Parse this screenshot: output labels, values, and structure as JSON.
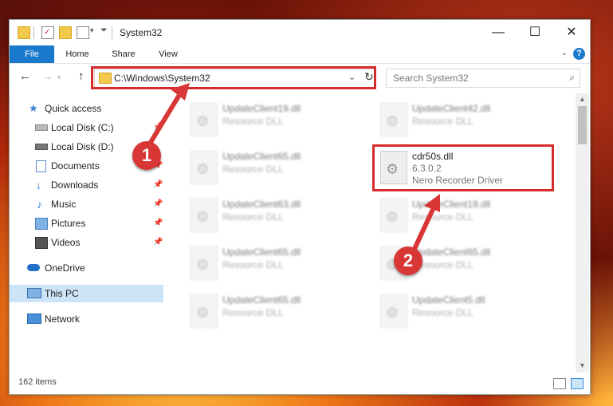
{
  "window": {
    "title": "System32"
  },
  "ribbon": {
    "tabs": [
      "File",
      "Home",
      "Share",
      "View"
    ],
    "help": "?"
  },
  "nav": {
    "back": "←",
    "forward": "→",
    "up": "↑",
    "address": "C:\\Windows\\System32",
    "search_placeholder": "Search System32"
  },
  "sidebar": {
    "items": [
      {
        "label": "Quick access",
        "icon": "star-icon"
      },
      {
        "label": "Local Disk (C:)",
        "icon": "drive-icon"
      },
      {
        "label": "Local Disk (D:)",
        "icon": "drive-icon"
      },
      {
        "label": "Documents",
        "icon": "documents-icon"
      },
      {
        "label": "Downloads",
        "icon": "download-icon"
      },
      {
        "label": "Music",
        "icon": "music-icon"
      },
      {
        "label": "Pictures",
        "icon": "pictures-icon"
      },
      {
        "label": "Videos",
        "icon": "videos-icon"
      },
      {
        "label": "OneDrive",
        "icon": "cloud-icon"
      },
      {
        "label": "This PC",
        "icon": "computer-icon"
      },
      {
        "label": "Network",
        "icon": "network-icon"
      }
    ]
  },
  "files": {
    "left": [
      {
        "name": "UpdateClient19.dll",
        "type": "Resource DLL"
      },
      {
        "name": "UpdateClient65.dll",
        "type": "Resource DLL"
      },
      {
        "name": "UpdateClient63.dll",
        "type": "Resource DLL"
      },
      {
        "name": "UpdateClient65.dll",
        "type": "Resource DLL"
      },
      {
        "name": "UpdateClient65.dll",
        "type": "Resource DLL"
      }
    ],
    "right": [
      {
        "name": "UpdateClient42.dll",
        "type": "Resource DLL"
      },
      {
        "name": "UpdateClient19.dll",
        "type": "Resource DLL"
      },
      {
        "name": "UpdateClient65.dll",
        "type": "Resource DLL"
      },
      {
        "name": "UpdateClient5.dll",
        "type": "Resource DLL"
      }
    ],
    "highlight": {
      "name": "cdr50s.dll",
      "version": "6.3.0.2",
      "description": "Nero Recorder Driver"
    }
  },
  "status": {
    "count": "162 items"
  },
  "annotations": {
    "badge1": "1",
    "badge2": "2"
  },
  "colors": {
    "accent": "#1979ca",
    "highlight_box": "#d62b2b",
    "badge": "#d93636"
  }
}
